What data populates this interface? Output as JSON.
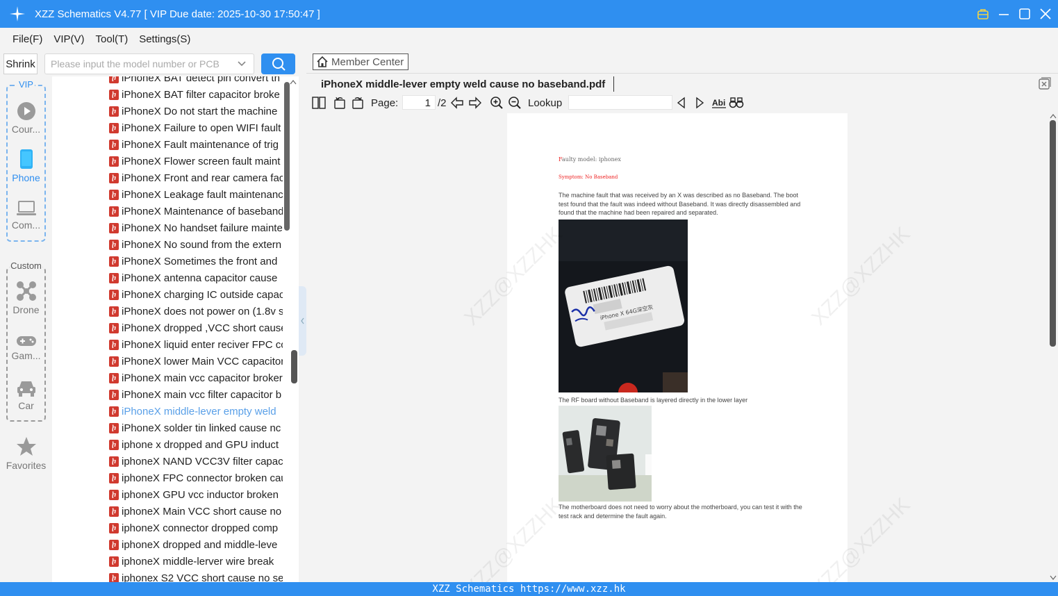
{
  "window": {
    "title": "XZZ Schematics V4.77 [ VIP Due date: 2025-10-30 17:50:47 ]"
  },
  "menu": [
    "File(F)",
    "VIP(V)",
    "Tool(T)",
    "Settings(S)"
  ],
  "leftnav": {
    "shrink_label": "Shrink",
    "vip_label": "VIP",
    "custom_label": "Custom",
    "items": [
      {
        "label": "Cour...",
        "icon": "play-circle-icon"
      },
      {
        "label": "Phone",
        "icon": "phone-icon"
      },
      {
        "label": "Com...",
        "icon": "laptop-icon"
      },
      {
        "label": "Drone",
        "icon": "drone-icon"
      },
      {
        "label": "Gam...",
        "icon": "gamepad-icon"
      },
      {
        "label": "Car",
        "icon": "car-icon"
      },
      {
        "label": "Favorites",
        "icon": "star-icon"
      }
    ]
  },
  "search": {
    "placeholder": "Please input the model number or PCB"
  },
  "filelist": {
    "items": [
      "iPhoneX BAT detect pin convert th",
      "iPhoneX BAT filter capacitor broke",
      "iPhoneX Do not start the machine",
      "iPhoneX Failure to open WIFI fault",
      "iPhoneX Fault maintenance of trig",
      "iPhoneX Flower screen fault maint",
      "iPhoneX Front and rear camera fac",
      "iPhoneX Leakage fault maintenanc",
      "iPhoneX Maintenance of baseband",
      "iPhoneX No handset failure mainte",
      "iPhoneX No sound from the extern",
      "iPhoneX Sometimes the front and",
      "iPhoneX antenna capacitor cause",
      "iPhoneX charging IC outside capac",
      "iPhoneX does not power on (1.8v s",
      "iPhoneX dropped ,VCC short cause",
      "iPhoneX liquid enter reciver FPC cc",
      "iPhoneX lower Main VCC capacitor",
      "iPhoneX main vcc capacitor broker",
      "iPhoneX main vcc filter capacitor b",
      "iPhoneX middle-lever empty weld",
      "iPhoneX solder tin linked cause nc",
      "iphone x dropped and GPU induct",
      "iphoneX  NAND VCC3V filter capac",
      "iphoneX FPC connector broken cau",
      "iphoneX GPU vcc inductor broken",
      "iphoneX Main VCC short cause no",
      "iphoneX connector dropped comp",
      "iphoneX dropped and middle-leve",
      "iphoneX middle-lerver wire break",
      "iphonex S2 VCC short cause no ser"
    ],
    "selected_index": 20
  },
  "viewer": {
    "member_center": "Member Center",
    "tab_title": "iPhoneX middle-lever empty weld cause no baseband.pdf",
    "page_label": "Page:",
    "page_current": "1",
    "page_total": "/2",
    "lookup_label": "Lookup",
    "lookup_value": ""
  },
  "document": {
    "faulty_model_first": "F",
    "faulty_model_rest": "aulty model: iphonex",
    "symptom": "Symptom: No Baseband",
    "paragraph1": "The machine fault that was received by an X was described as no Baseband. The boot test found that the fault was indeed without Baseband. It was directly disassembled and found that the machine had been repaired and separated.",
    "card_text": "iPhone X 64G深空灰",
    "caption1": "The RF board without Baseband is layered directly in the lower layer",
    "caption2": "The motherboard does not need to worry about the motherboard, you can test it with the test rack and determine the fault again.",
    "watermark": "XZZ@XZZHK"
  },
  "statusbar": {
    "text": "XZZ Schematics https://www.xzz.hk"
  },
  "colors": {
    "accent": "#2f8ff0",
    "pdf_icon": "#d03a2f",
    "selected_text": "#5aa0e8",
    "symptom_red": "#e22222"
  }
}
